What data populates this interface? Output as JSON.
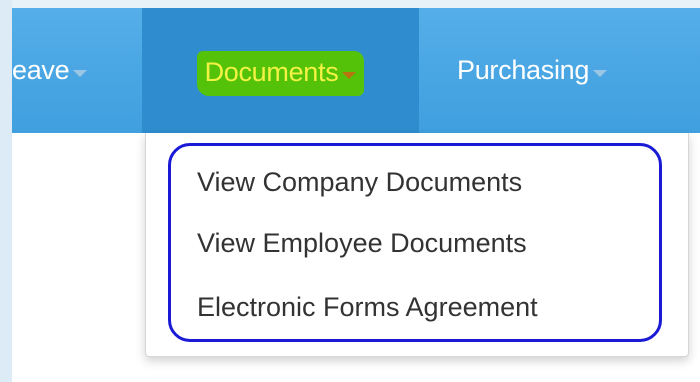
{
  "navbar": {
    "items": [
      {
        "label": "eave"
      },
      {
        "label": "Documents"
      },
      {
        "label": "Purchasing"
      }
    ]
  },
  "dropdown": {
    "items": [
      {
        "label": "View Company Documents"
      },
      {
        "label": "View Employee Documents"
      },
      {
        "label": "Electronic Forms Agreement"
      }
    ]
  },
  "colors": {
    "navbar_bg": "#4aa8e6",
    "active_tab_bg": "#2f8dcf",
    "highlight_marker": "#55c20a",
    "highlight_text": "#f2f244",
    "annotation_outline": "#1a1ad6"
  }
}
